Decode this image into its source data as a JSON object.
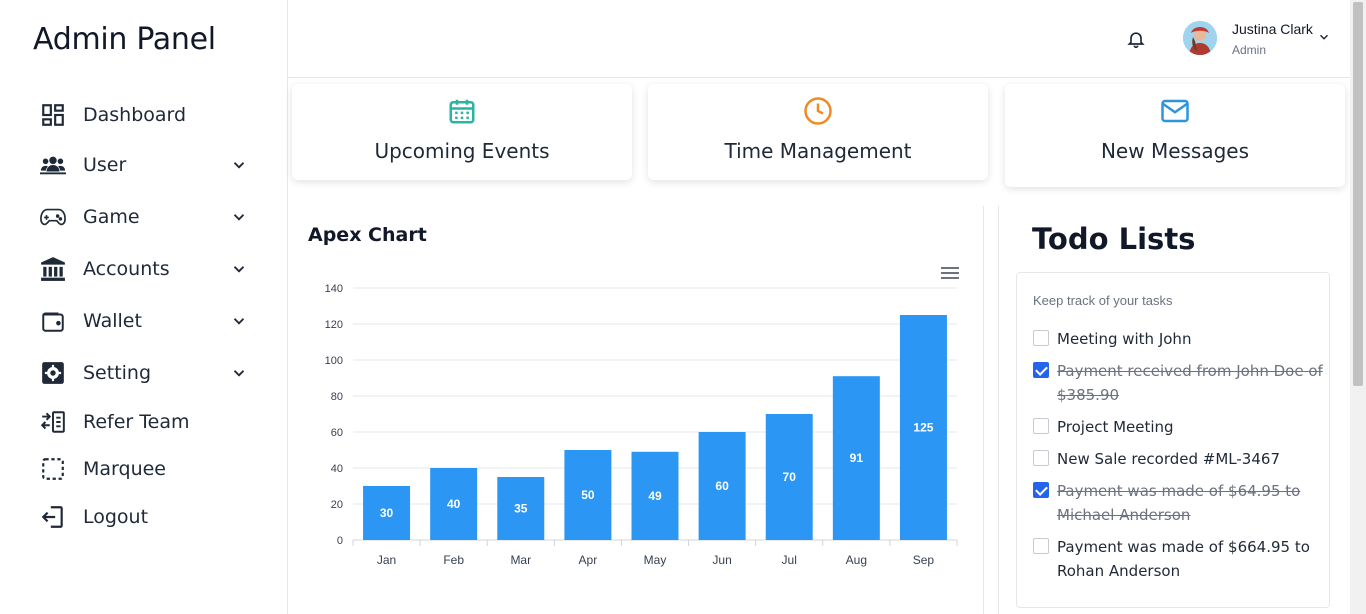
{
  "brand": "Admin Panel",
  "sidebar": {
    "items": [
      {
        "label": "Dashboard",
        "icon": "dashboard-icon",
        "has_chevron": false
      },
      {
        "label": "User",
        "icon": "users-icon",
        "has_chevron": true
      },
      {
        "label": "Game",
        "icon": "gamepad-icon",
        "has_chevron": true
      },
      {
        "label": "Accounts",
        "icon": "bank-icon",
        "has_chevron": true
      },
      {
        "label": "Wallet",
        "icon": "wallet-icon",
        "has_chevron": true
      },
      {
        "label": "Setting",
        "icon": "gear-icon",
        "has_chevron": true
      },
      {
        "label": "Refer Team",
        "icon": "refer-icon",
        "has_chevron": false
      },
      {
        "label": "Marquee",
        "icon": "marquee-icon",
        "has_chevron": false
      },
      {
        "label": "Logout",
        "icon": "logout-icon",
        "has_chevron": false
      }
    ]
  },
  "header": {
    "user_name": "Justina Clark",
    "user_role": "Admin"
  },
  "cards": [
    {
      "title": "Upcoming Events",
      "icon": "calendar-icon",
      "color": "#2bb3a3"
    },
    {
      "title": "Time Management",
      "icon": "clock-icon",
      "color": "#f08a24"
    },
    {
      "title": "New Messages",
      "icon": "mail-icon",
      "color": "#2b95e0"
    }
  ],
  "chart": {
    "title": "Apex Chart"
  },
  "chart_data": {
    "type": "bar",
    "categories": [
      "Jan",
      "Feb",
      "Mar",
      "Apr",
      "May",
      "Jun",
      "Jul",
      "Aug",
      "Sep"
    ],
    "values": [
      30,
      40,
      35,
      50,
      49,
      60,
      70,
      91,
      125
    ],
    "ylim": [
      0,
      140
    ],
    "yticks": [
      0,
      20,
      40,
      60,
      80,
      100,
      120,
      140
    ],
    "color": "#2b96f3",
    "grid": true,
    "data_labels": true
  },
  "todo": {
    "title": "Todo Lists",
    "subtitle": "Keep track of your tasks",
    "items": [
      {
        "text": "Meeting with John",
        "done": false
      },
      {
        "text": "Payment received from John Doe of $385.90",
        "done": true
      },
      {
        "text": "Project Meeting",
        "done": false
      },
      {
        "text": "New Sale recorded #ML-3467",
        "done": false
      },
      {
        "text": "Payment was made of $64.95 to Michael Anderson",
        "done": true
      },
      {
        "text": "Payment was made of $664.95 to Rohan Anderson",
        "done": false
      }
    ]
  }
}
